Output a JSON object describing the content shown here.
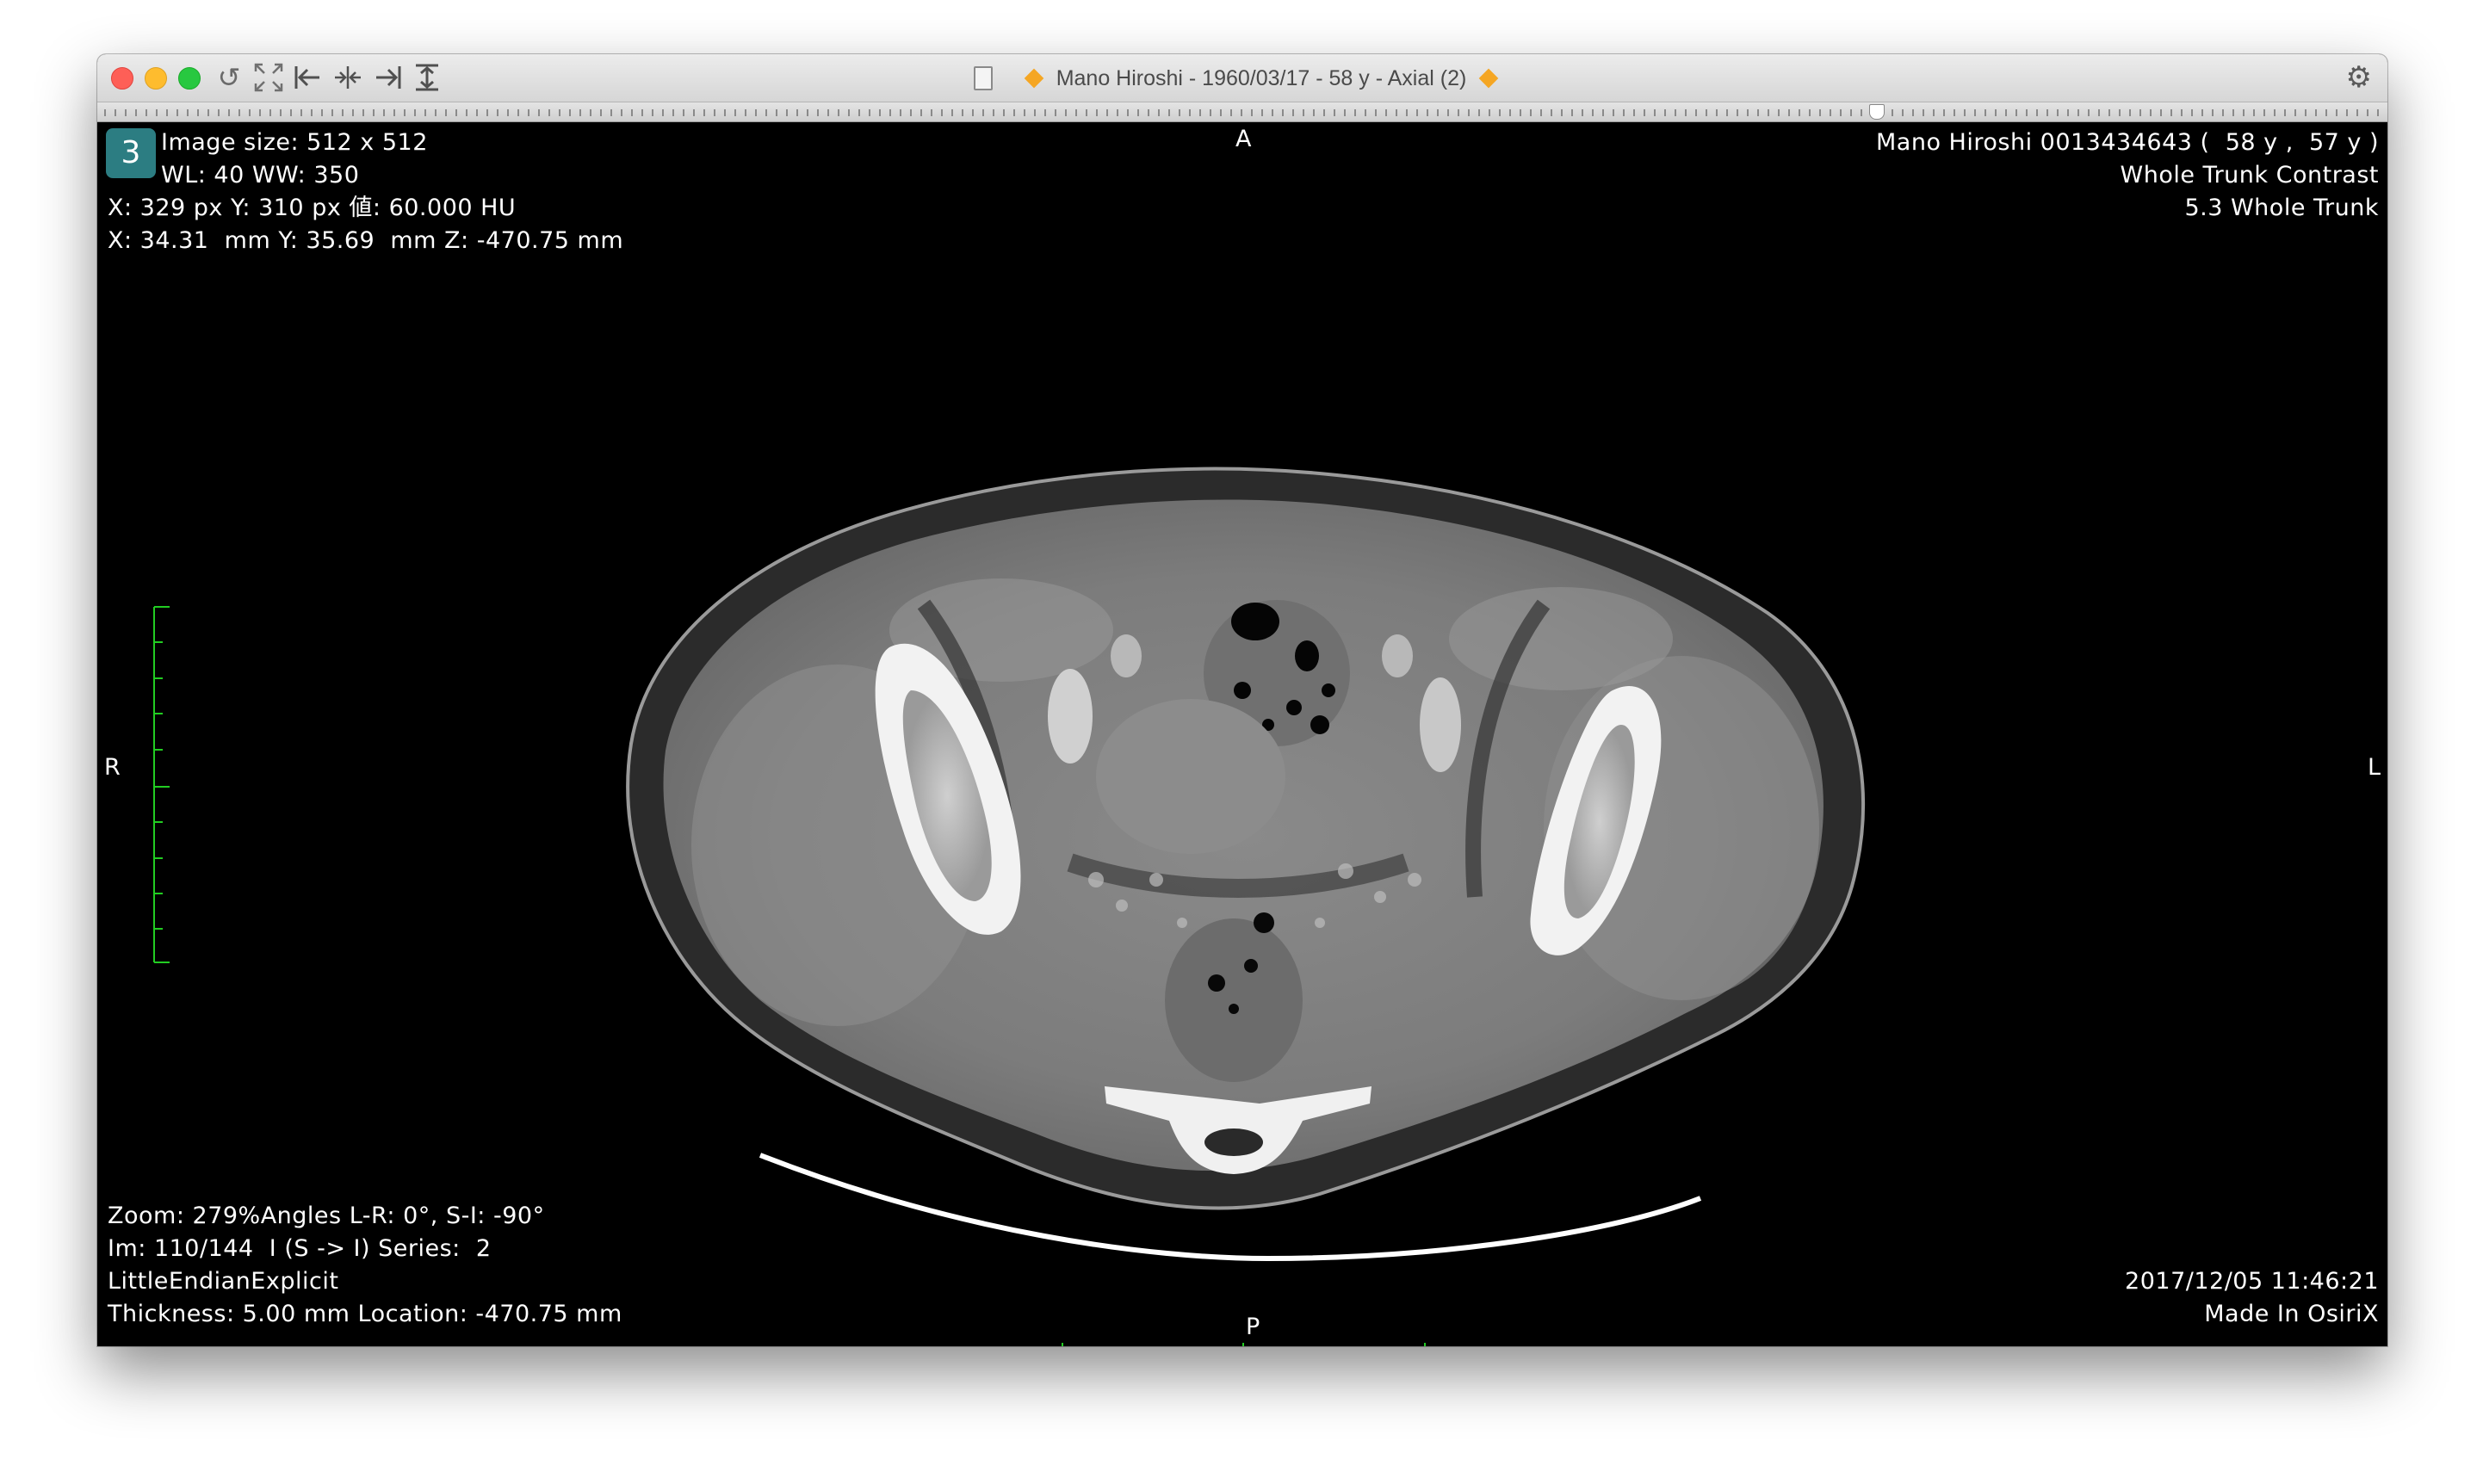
{
  "window": {
    "title": "Mano Hiroshi - 1960/03/17 - 58 y - Axial (2)"
  },
  "toolbar": {
    "icons": [
      "reset-icon",
      "fullscreen-icon",
      "first-image-icon",
      "sync-icon",
      "last-image-icon",
      "stack-icon",
      "settings-gear-icon"
    ],
    "slider_position": 0.78
  },
  "overlay": {
    "series_badge": "3",
    "top_left": {
      "image_size": "Image size: 512 x 512",
      "window": "WL: 40 WW: 350",
      "pixel": "X: 329 px Y: 310 px 値: 60.000 HU",
      "mm": "X: 34.31  mm Y: 35.69  mm Z: -470.75 mm"
    },
    "top_right": {
      "patient": "Mano Hiroshi 0013434643 (  58 y ,  57 y )",
      "study": "Whole Trunk Contrast",
      "series": "5.3 Whole Trunk"
    },
    "bottom_left": {
      "zoom": "Zoom: 279%Angles L-R: 0°, S-I: -90°",
      "image": "Im: 110/144  I (S -> I) Series:  2",
      "transfer": "LittleEndianExplicit",
      "thickness": "Thickness: 5.00 mm Location: -470.75 mm"
    },
    "bottom_right": {
      "datetime": "2017/12/05 11:46:21",
      "made_in": "Made In OsiriX"
    },
    "orientation": {
      "top": "A",
      "bottom": "P",
      "left": "R",
      "right": "L"
    }
  },
  "colors": {
    "scale_bar": "#22cc22",
    "series_badge": "#2c7d82",
    "title_diamond": "#f5a623"
  }
}
